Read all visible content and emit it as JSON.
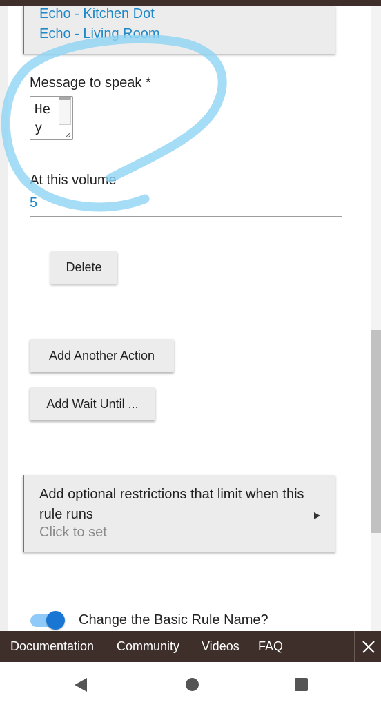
{
  "devices": [
    "Echo - Kitchen Dot",
    "Echo - Living Room"
  ],
  "message_field": {
    "label": "Message to speak *",
    "value": "Hey"
  },
  "volume_field": {
    "label": "At this volume",
    "value": "5"
  },
  "buttons": {
    "delete": "Delete",
    "add_another_action": "Add Another Action",
    "add_wait_until": "Add Wait Until ..."
  },
  "restrictions": {
    "title": "Add optional restrictions that limit when this rule runs",
    "subtitle": "Click to set"
  },
  "toggle": {
    "label": "Change the Basic Rule Name?",
    "on": true
  },
  "footer": {
    "links": [
      "Documentation",
      "Community",
      "Videos",
      "FAQ"
    ]
  },
  "colors": {
    "link_blue": "#1e88c8",
    "footer_bg": "#3e2f2b",
    "toggle_on": "#1976d2",
    "annotation_stroke": "#8fd3f4"
  },
  "icons": {
    "footer_close": "close-icon",
    "restrictions_expand": "play-arrow-icon",
    "nav_back": "back-triangle-icon",
    "nav_home": "home-circle-icon",
    "nav_recent": "recents-square-icon"
  }
}
